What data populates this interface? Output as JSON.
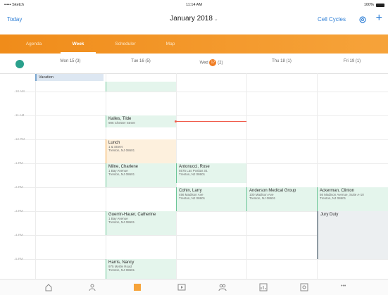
{
  "status_bar": {
    "carrier": "••••• Sketch",
    "time": "11:14 AM",
    "battery": "100%"
  },
  "nav": {
    "today_label": "Today",
    "title": "January 2018",
    "cell_cycles_label": "Cell Cycles",
    "settings_icon": "gear-icon",
    "add_icon": "plus-icon"
  },
  "tabs": [
    {
      "label": "Agenda",
      "active": false
    },
    {
      "label": "Week",
      "active": true
    },
    {
      "label": "Scheduler",
      "active": false
    },
    {
      "label": "Map",
      "active": false
    }
  ],
  "days": [
    {
      "label": "Mon 15",
      "count": "(3)"
    },
    {
      "label": "Tue 16",
      "count": "(5)"
    },
    {
      "label": "Wed",
      "badge": "17",
      "count": "(2)"
    },
    {
      "label": "Thu 18",
      "count": "(1)"
    },
    {
      "label": "Fri 19",
      "count": "(1)"
    }
  ],
  "time_labels": [
    "10 AM",
    "11 AM",
    "12 PM",
    "1 PM",
    "2 PM",
    "3 PM",
    "4 PM",
    "5 PM"
  ],
  "all_day_event": "Vacation",
  "events": {
    "kalles": {
      "name": "Kalles, Tilde",
      "addr1": "906 Chester Street",
      "addr2": ""
    },
    "lunch": {
      "name": "Lunch",
      "addr1": "1 & Street",
      "addr2": "Trenton, NJ 08601"
    },
    "milne": {
      "name": "Milne, Charlene",
      "addr1": "1 Bay Avenue",
      "addr2": "Trenton, NJ 08601"
    },
    "antonucci": {
      "name": "Antonucci, Rose",
      "addr1": "5575 Las Positas St.",
      "addr2": "Trenton, NJ 08601"
    },
    "cohin": {
      "name": "Cohin, Larry",
      "addr1": "456 Madison Ave",
      "addr2": "Trenton, NJ 08601"
    },
    "anderson": {
      "name": "Anderson Medical Group",
      "addr1": "100 Madison Ave",
      "addr2": "Trenton, NJ 08601"
    },
    "ackerman": {
      "name": "Ackerman, Clinton",
      "addr1": "56 Madison Avenue, Suite A-10",
      "addr2": "Trenton, NJ 08601"
    },
    "jury": {
      "name": "Jury Duty",
      "addr1": "",
      "addr2": ""
    },
    "guerrin": {
      "name": "Guerrin-Hauer, Catherine",
      "addr1": "1 Bay Avenue",
      "addr2": "Trenton, NJ 08601"
    },
    "harris": {
      "name": "Harris, Nancy",
      "addr1": "975 Myrtle Road",
      "addr2": "Trenton, NJ 08601"
    }
  },
  "bottom_tabs": [
    "home-icon",
    "contacts-icon",
    "calendar-icon",
    "presentation-icon",
    "team-icon",
    "reports-icon",
    "settings-icon",
    "more-icon"
  ],
  "more_label": "•••",
  "colors": {
    "accent": "#2f7fd6",
    "brand_orange": "#f08c1a",
    "today_badge": "#f07c22"
  }
}
